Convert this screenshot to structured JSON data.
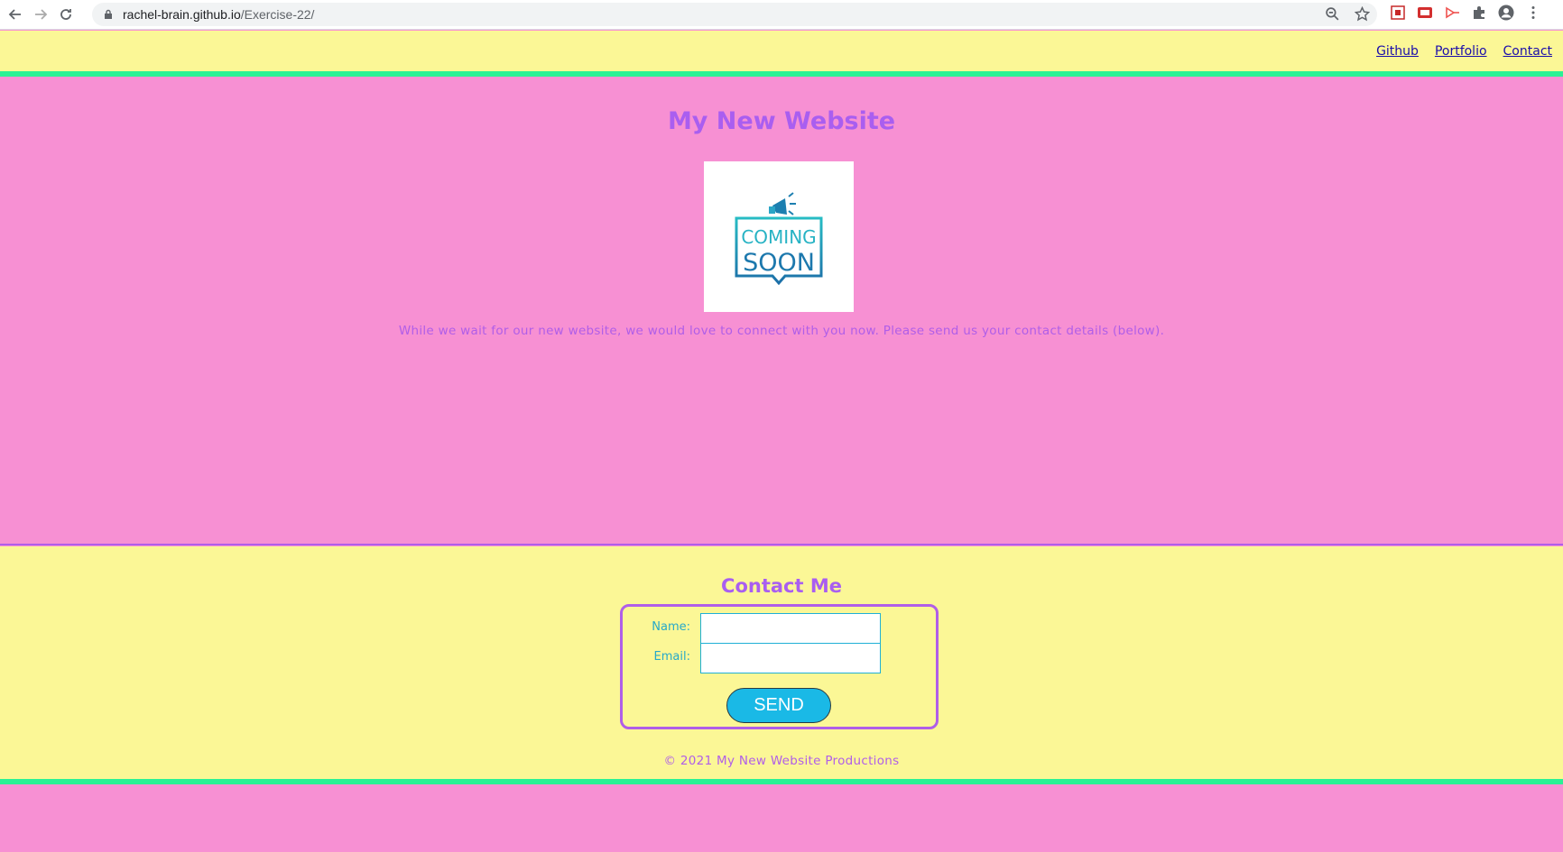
{
  "browser": {
    "url_host": "rachel-brain.github.io",
    "url_path": "/Exercise-22/"
  },
  "nav": {
    "links": [
      {
        "label": "Github"
      },
      {
        "label": "Portfolio"
      },
      {
        "label": "Contact"
      }
    ],
    "link_color": "#1a0dab"
  },
  "hero": {
    "title": "My New Website",
    "image_text": [
      "COMING",
      "SOON"
    ],
    "text": "While we wait for our new website, we would love to connect with you now. Please send us your contact details (below)."
  },
  "contact": {
    "title": "Contact Me",
    "name_label": "Name:",
    "email_label": "Email:",
    "name_value": "",
    "email_value": "",
    "send_label": "SEND"
  },
  "footer": {
    "copyright": "© 2021 My New Website Productions"
  },
  "colors": {
    "pink": "#f790d3",
    "yellow": "#fbf796",
    "green": "#2af195",
    "purple": "#a95ef0",
    "cyan": "#1ab9e6"
  }
}
